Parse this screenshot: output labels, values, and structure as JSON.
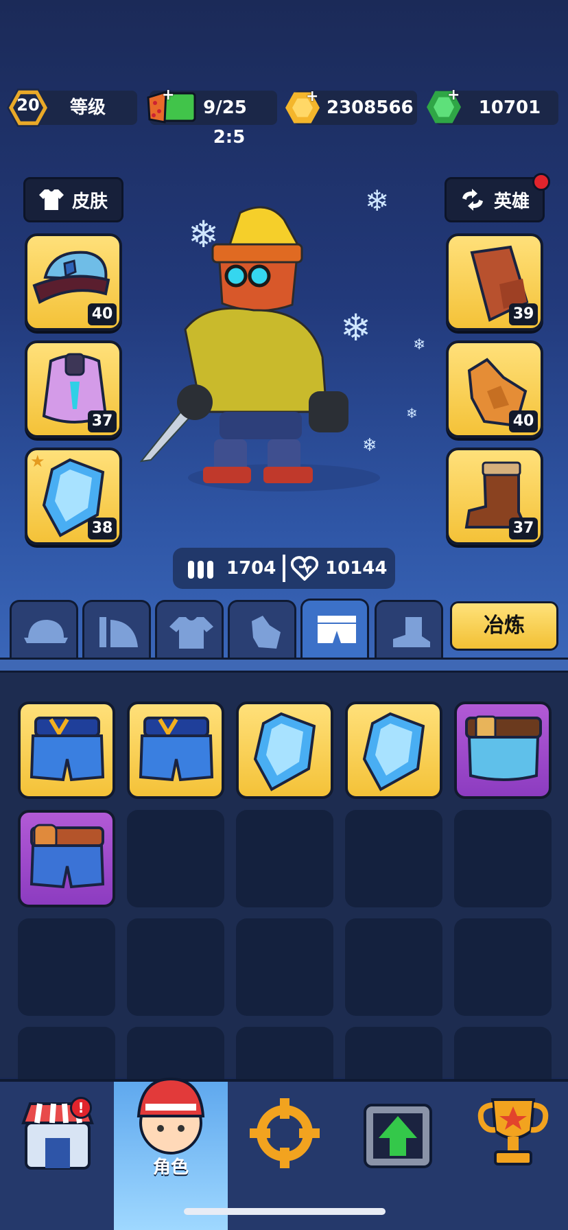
{
  "topbar": {
    "level": "20",
    "level_label": "等级",
    "energy": "9/25",
    "energy_timer": "2:5",
    "coins": "2308566",
    "gems": "10701"
  },
  "buttons": {
    "skin_label": "皮肤",
    "hero_label": "英雄",
    "refine_label": "冶炼"
  },
  "left_slots": [
    {
      "item": "police-hat",
      "level": "40"
    },
    {
      "item": "purple-vest",
      "level": "37"
    },
    {
      "item": "blue-crystal",
      "level": "38"
    }
  ],
  "right_slots": [
    {
      "item": "leather-arm-guard",
      "level": "39"
    },
    {
      "item": "leather-glove",
      "level": "40"
    },
    {
      "item": "brown-boot",
      "level": "37"
    }
  ],
  "stats": {
    "ammo": "1704",
    "health": "10144"
  },
  "tabs": [
    "hat-icon",
    "cape-icon",
    "shirt-icon",
    "glove-icon",
    "pants-icon",
    "boot-icon"
  ],
  "active_tab": 4,
  "inventory": [
    "blue-shorts",
    "blue-shorts",
    "blue-crystal",
    "blue-crystal",
    "belt-shorts",
    "orange-belt-jeans"
  ],
  "nav": {
    "character_label": "角色",
    "items": [
      "shop-icon",
      "character-icon",
      "target-icon",
      "upgrade-icon",
      "trophy-icon"
    ]
  },
  "colors": {
    "gold": "#f4c238",
    "purple": "#9a46c8",
    "gem_green": "#3fcf5a",
    "tab_active": "#3c71c8"
  }
}
